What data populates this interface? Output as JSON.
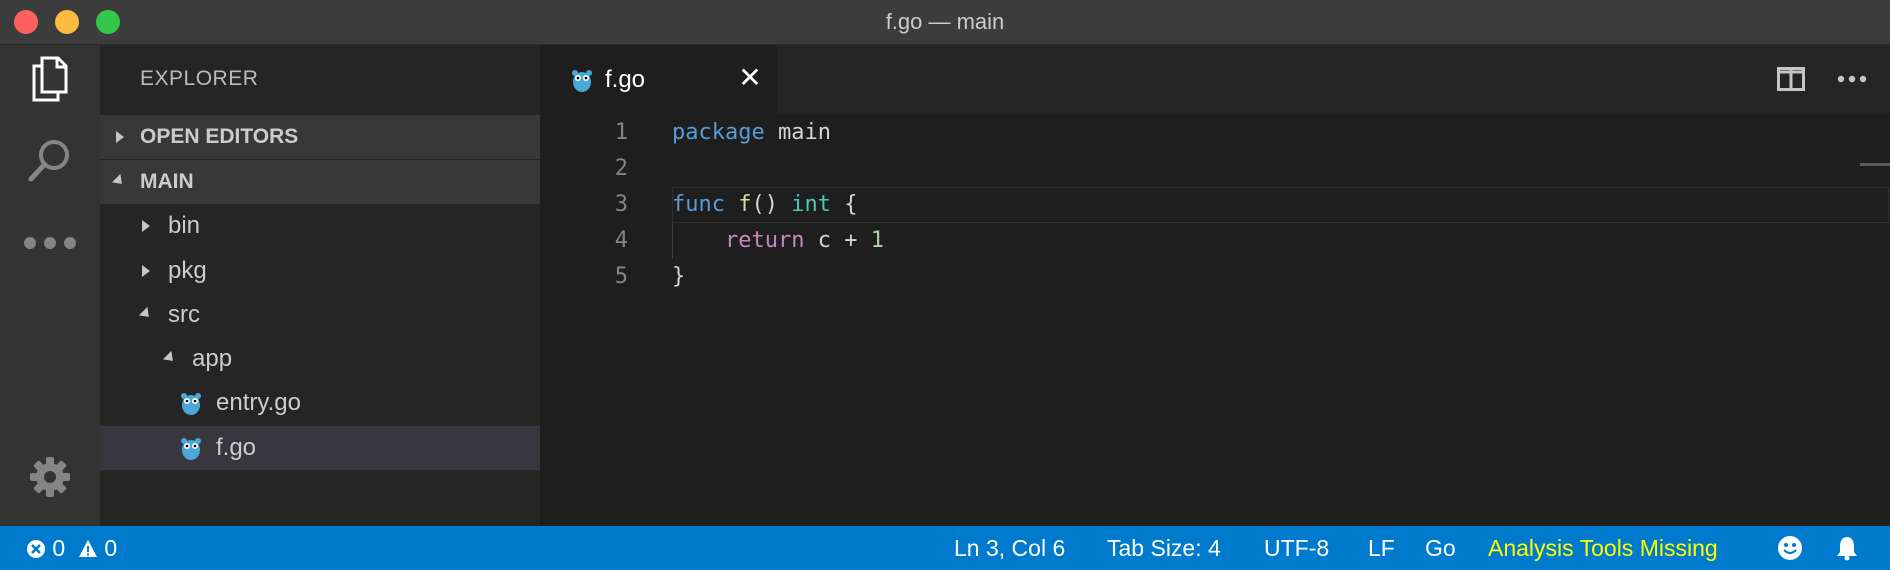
{
  "window": {
    "title": "f.go — main"
  },
  "activity_bar": {
    "items": [
      {
        "icon": "files-icon"
      },
      {
        "icon": "search-icon"
      },
      {
        "icon": "more-icon"
      },
      {
        "icon": "gear-icon"
      }
    ]
  },
  "sidebar": {
    "title": "EXPLORER",
    "sections": [
      {
        "label": "OPEN EDITORS",
        "expanded": false
      },
      {
        "label": "MAIN",
        "expanded": true
      }
    ],
    "tree": [
      {
        "label": "bin",
        "type": "folder",
        "expanded": false
      },
      {
        "label": "pkg",
        "type": "folder",
        "expanded": false
      },
      {
        "label": "src",
        "type": "folder",
        "expanded": true
      },
      {
        "label": "app",
        "type": "folder",
        "expanded": true
      },
      {
        "label": "entry.go",
        "type": "file"
      },
      {
        "label": "f.go",
        "type": "file",
        "selected": true
      }
    ]
  },
  "tabs": [
    {
      "label": "f.go",
      "active": true
    }
  ],
  "editor": {
    "line_numbers": [
      "1",
      "2",
      "3",
      "4",
      "5"
    ],
    "lines": {
      "l1_kw": "package",
      "l1_rest": " main",
      "l3_kw": "func",
      "l3_fn": "f",
      "l3_paren": "()",
      "l3_ty": "int",
      "l3_brace": " {",
      "l4_indent": "    ",
      "l4_kw": "return",
      "l4_mid": " c + ",
      "l4_num": "1",
      "l5": "}"
    }
  },
  "status_bar": {
    "errors": "0",
    "warnings": "0",
    "position": "Ln 3, Col 6",
    "tab_size": "Tab Size: 4",
    "encoding": "UTF-8",
    "eol": "LF",
    "language": "Go",
    "tools_warning": "Analysis Tools Missing"
  },
  "colors": {
    "accent": "#007acc",
    "warning_text": "#ffff00",
    "gopher": "#4aa8d8"
  }
}
